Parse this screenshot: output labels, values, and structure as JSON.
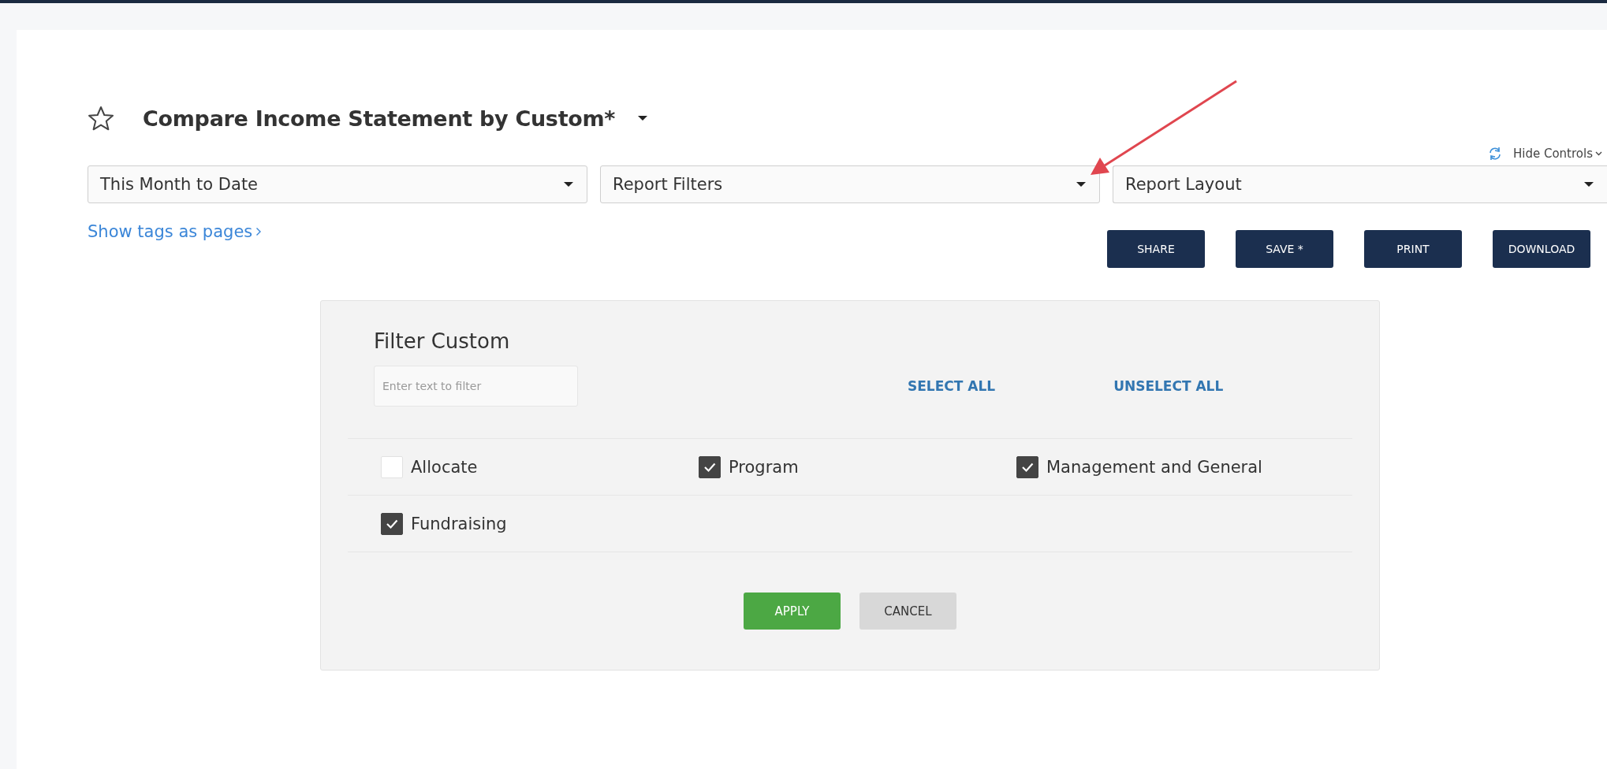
{
  "report": {
    "title": "Compare Income Statement by Custom*"
  },
  "hide_controls": "Hide Controls",
  "dropdowns": [
    {
      "value": "This Month to Date"
    },
    {
      "value": "Report Filters"
    },
    {
      "value": "Report Layout"
    }
  ],
  "link": "Show tags as pages",
  "actions": [
    "SHARE",
    "SAVE *",
    "PRINT",
    "DOWNLOAD"
  ],
  "filter_panel": {
    "title": "Filter Custom",
    "search": {
      "placeholder": "Enter text to filter"
    },
    "select_all": "SELECT ALL",
    "unselect_all": "UNSELECT ALL",
    "options": [
      {
        "label": "Allocate",
        "checked": false
      },
      {
        "label": "Program",
        "checked": true
      },
      {
        "label": "Management and General",
        "checked": true
      },
      {
        "label": "Fundraising",
        "checked": true
      }
    ],
    "buttons": [
      {
        "label": "APPLY",
        "kind": "primary"
      },
      {
        "label": "CANCEL",
        "kind": "secondary"
      }
    ]
  }
}
